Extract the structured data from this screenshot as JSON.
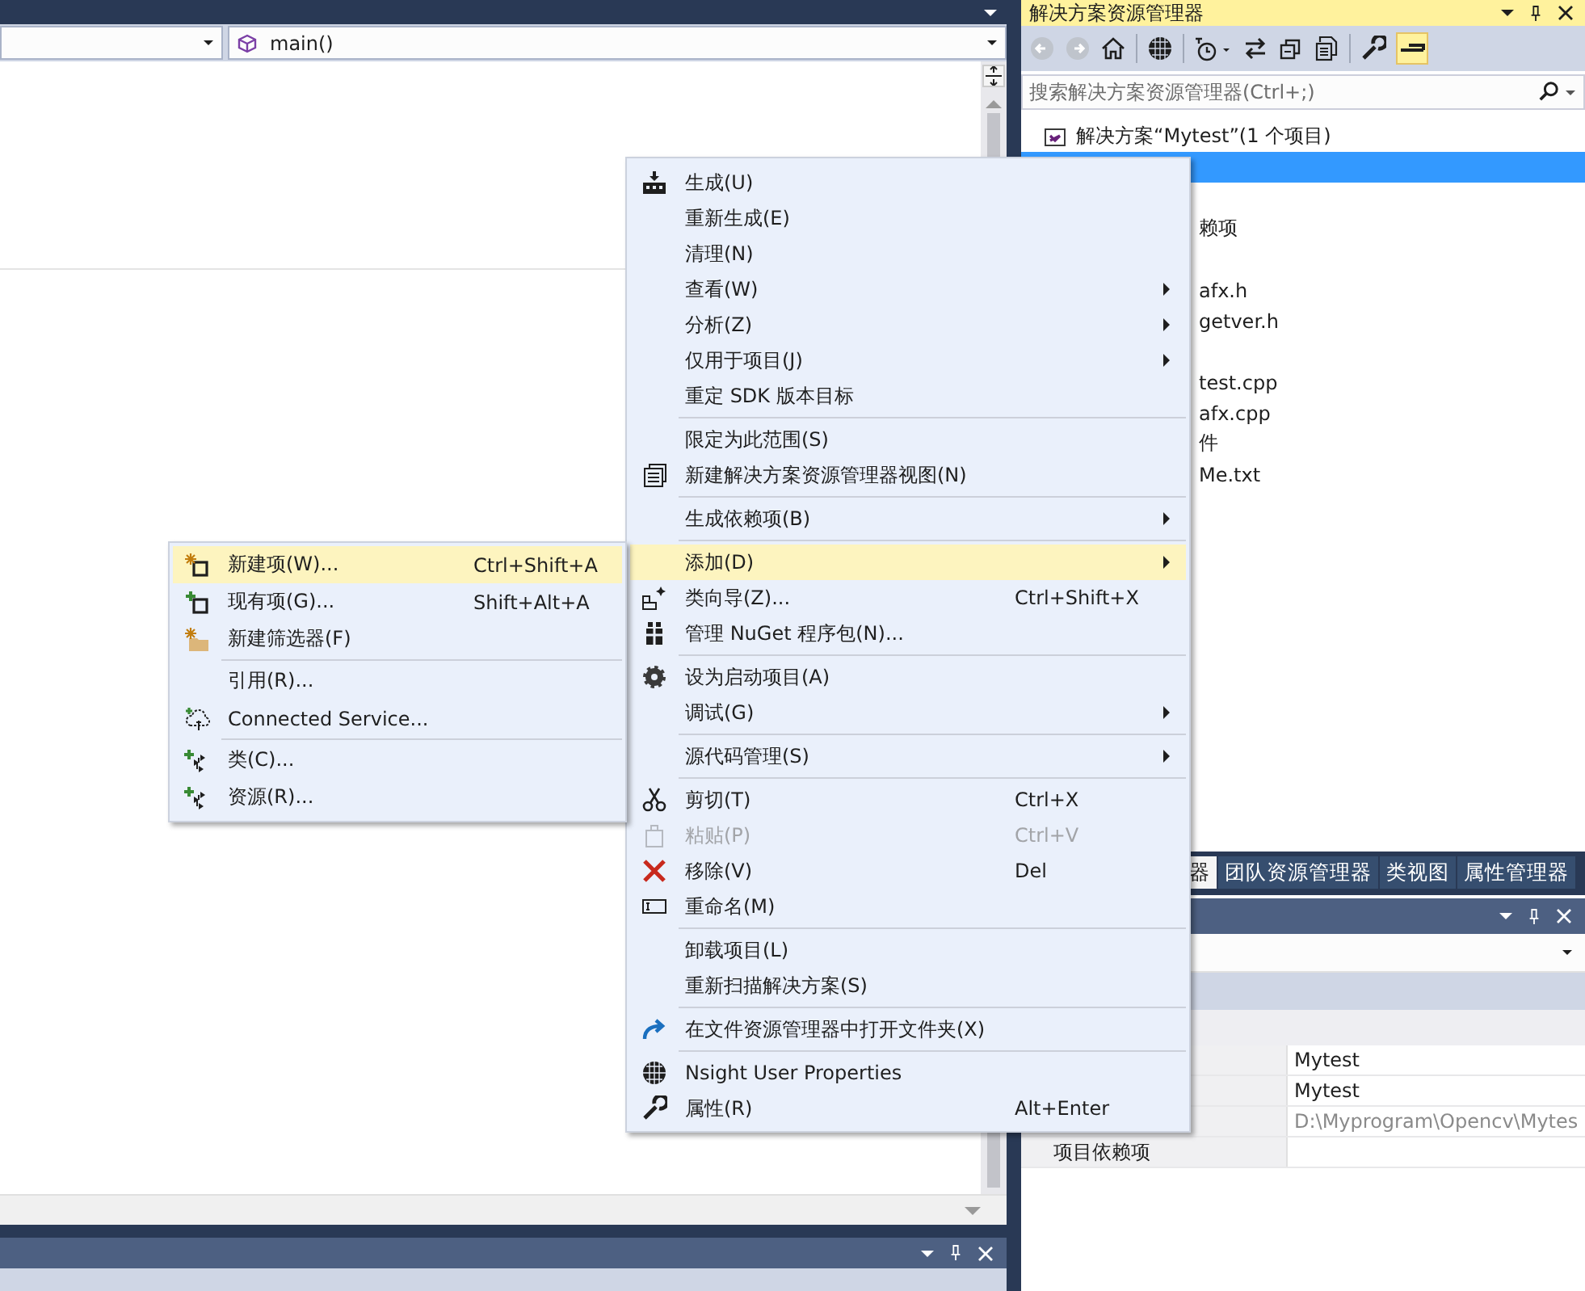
{
  "editor": {
    "nav_dropdowns": [
      {
        "kind": "scope"
      },
      {
        "kind": "member",
        "value": "main()"
      }
    ]
  },
  "solution_explorer": {
    "title": "解决方案资源管理器",
    "search": {
      "placeholder": "搜索解决方案资源管理器(Ctrl+;)"
    },
    "tree": [
      {
        "label": "解决方案“Mytest”(1 个项目)",
        "kind": "solution",
        "selected": false
      },
      {
        "kind": "row",
        "selected": true
      },
      {
        "kind": "row",
        "selected": false
      },
      {
        "label": "赖项",
        "kind": "row",
        "selected": false
      },
      {
        "kind": "row",
        "selected": false
      },
      {
        "label": "afx.h",
        "kind": "row",
        "selected": false
      },
      {
        "label": "getver.h",
        "kind": "row",
        "selected": false
      },
      {
        "kind": "row",
        "selected": false
      },
      {
        "label": "test.cpp",
        "kind": "row",
        "selected": false
      },
      {
        "label": "afx.cpp",
        "kind": "row",
        "selected": false
      },
      {
        "label": "件",
        "kind": "row",
        "selected": false
      },
      {
        "label": "Me.txt",
        "kind": "row",
        "selected": false
      }
    ]
  },
  "panel_tabs": [
    {
      "label": "器",
      "selected": true
    },
    {
      "label": "团队资源管理器",
      "selected": false
    },
    {
      "label": "类视图",
      "selected": false
    },
    {
      "label": "属性管理器",
      "selected": false
    }
  ],
  "properties": {
    "rows": [
      {
        "value": "Mytest",
        "dim": false
      },
      {
        "value": "Mytest",
        "dim": false
      },
      {
        "value": "D:\\Myprogram\\Opencv\\Mytes",
        "dim": true
      },
      {
        "label": "项目依赖项"
      }
    ]
  },
  "context_menu": [
    {
      "kind": "item",
      "label": "生成(U)",
      "submenu": false,
      "selected": false,
      "disabled": false
    },
    {
      "kind": "item",
      "label": "重新生成(E)",
      "submenu": false,
      "selected": false,
      "disabled": false
    },
    {
      "kind": "item",
      "label": "清理(N)",
      "submenu": false,
      "selected": false,
      "disabled": false
    },
    {
      "kind": "item",
      "label": "查看(W)",
      "submenu": true,
      "selected": false,
      "disabled": false
    },
    {
      "kind": "item",
      "label": "分析(Z)",
      "submenu": true,
      "selected": false,
      "disabled": false
    },
    {
      "kind": "item",
      "label": "仅用于项目(J)",
      "submenu": true,
      "selected": false,
      "disabled": false
    },
    {
      "kind": "item",
      "label": "重定 SDK 版本目标",
      "submenu": false,
      "selected": false,
      "disabled": false
    },
    {
      "kind": "separator"
    },
    {
      "kind": "item",
      "label": "限定为此范围(S)",
      "submenu": false,
      "selected": false,
      "disabled": false
    },
    {
      "kind": "item",
      "label": "新建解决方案资源管理器视图(N)",
      "submenu": false,
      "selected": false,
      "disabled": false
    },
    {
      "kind": "separator"
    },
    {
      "kind": "item",
      "label": "生成依赖项(B)",
      "submenu": true,
      "selected": false,
      "disabled": false
    },
    {
      "kind": "separator"
    },
    {
      "kind": "item",
      "label": "添加(D)",
      "submenu": true,
      "selected": true,
      "disabled": false
    },
    {
      "kind": "item",
      "label": "类向导(Z)...",
      "shortcut": "Ctrl+Shift+X",
      "submenu": false,
      "selected": false,
      "disabled": false
    },
    {
      "kind": "item",
      "label": "管理 NuGet 程序包(N)...",
      "submenu": false,
      "selected": false,
      "disabled": false
    },
    {
      "kind": "separator"
    },
    {
      "kind": "item",
      "label": "设为启动项目(A)",
      "submenu": false,
      "selected": false,
      "disabled": false
    },
    {
      "kind": "item",
      "label": "调试(G)",
      "submenu": true,
      "selected": false,
      "disabled": false
    },
    {
      "kind": "separator"
    },
    {
      "kind": "item",
      "label": "源代码管理(S)",
      "submenu": true,
      "selected": false,
      "disabled": false
    },
    {
      "kind": "separator"
    },
    {
      "kind": "item",
      "label": "剪切(T)",
      "shortcut": "Ctrl+X",
      "submenu": false,
      "selected": false,
      "disabled": false
    },
    {
      "kind": "item",
      "label": "粘贴(P)",
      "shortcut": "Ctrl+V",
      "submenu": false,
      "selected": false,
      "disabled": true
    },
    {
      "kind": "item",
      "label": "移除(V)",
      "shortcut": "Del",
      "submenu": false,
      "selected": false,
      "disabled": false
    },
    {
      "kind": "item",
      "label": "重命名(M)",
      "submenu": false,
      "selected": false,
      "disabled": false
    },
    {
      "kind": "separator"
    },
    {
      "kind": "item",
      "label": "卸载项目(L)",
      "submenu": false,
      "selected": false,
      "disabled": false
    },
    {
      "kind": "item",
      "label": "重新扫描解决方案(S)",
      "submenu": false,
      "selected": false,
      "disabled": false
    },
    {
      "kind": "separator"
    },
    {
      "kind": "item",
      "label": "在文件资源管理器中打开文件夹(X)",
      "submenu": false,
      "selected": false,
      "disabled": false
    },
    {
      "kind": "separator"
    },
    {
      "kind": "item",
      "label": "Nsight User Properties",
      "submenu": false,
      "selected": false,
      "disabled": false
    },
    {
      "kind": "item",
      "label": "属性(R)",
      "shortcut": "Alt+Enter",
      "submenu": false,
      "selected": false,
      "disabled": false
    }
  ],
  "add_submenu": [
    {
      "kind": "item",
      "label": "新建项(W)...",
      "shortcut": "Ctrl+Shift+A",
      "submenu": false,
      "selected": true,
      "disabled": false
    },
    {
      "kind": "item",
      "label": "现有项(G)...",
      "shortcut": "Shift+Alt+A",
      "submenu": false,
      "selected": false,
      "disabled": false
    },
    {
      "kind": "item",
      "label": "新建筛选器(F)",
      "submenu": false,
      "selected": false,
      "disabled": false
    },
    {
      "kind": "separator"
    },
    {
      "kind": "item",
      "label": "引用(R)...",
      "submenu": false,
      "selected": false,
      "disabled": false
    },
    {
      "kind": "item",
      "label": "Connected Service...",
      "submenu": false,
      "selected": false,
      "disabled": false
    },
    {
      "kind": "separator"
    },
    {
      "kind": "item",
      "label": "类(C)...",
      "submenu": false,
      "selected": false,
      "disabled": false
    },
    {
      "kind": "item",
      "label": "资源(R)...",
      "submenu": false,
      "selected": false,
      "disabled": false
    }
  ]
}
